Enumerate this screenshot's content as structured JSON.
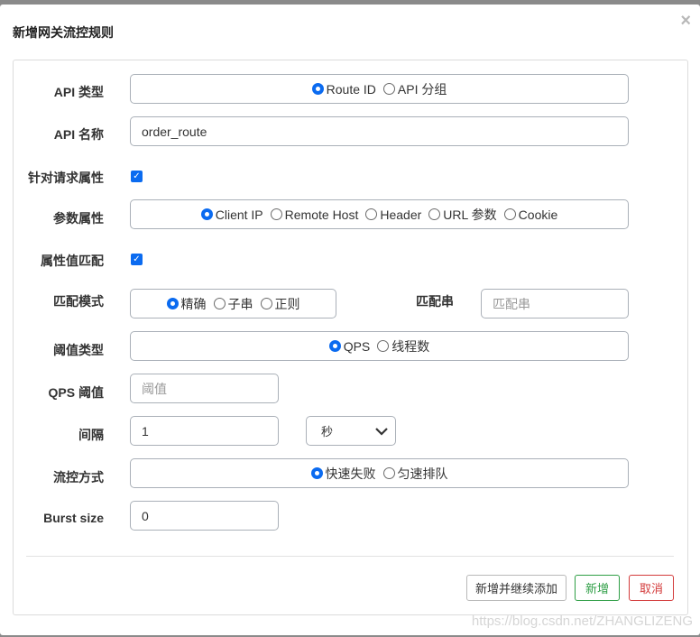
{
  "dialog": {
    "title": "新增网关流控规则",
    "close_glyph": "×"
  },
  "form": {
    "api_type": {
      "label": "API 类型",
      "options": [
        "Route ID",
        "API 分组"
      ],
      "selected": "Route ID"
    },
    "api_name": {
      "label": "API 名称",
      "value": "order_route"
    },
    "param_flag": {
      "label": "针对请求属性",
      "checked": true
    },
    "param_attr": {
      "label": "参数属性",
      "options": [
        "Client IP",
        "Remote Host",
        "Header",
        "URL 参数",
        "Cookie"
      ],
      "selected": "Client IP"
    },
    "match_flag": {
      "label": "属性值匹配",
      "checked": true
    },
    "match_mode": {
      "label": "匹配模式",
      "options": [
        "精确",
        "子串",
        "正则"
      ],
      "selected": "精确"
    },
    "match_str": {
      "label": "匹配串",
      "placeholder": "匹配串"
    },
    "threshold_type": {
      "label": "阈值类型",
      "options": [
        "QPS",
        "线程数"
      ],
      "selected": "QPS"
    },
    "qps": {
      "label": "QPS 阈值",
      "placeholder": "阈值"
    },
    "interval": {
      "label": "间隔",
      "value": "1",
      "unit": "秒"
    },
    "control": {
      "label": "流控方式",
      "options": [
        "快速失败",
        "匀速排队"
      ],
      "selected": "快速失败"
    },
    "burst": {
      "label": "Burst size",
      "value": "0"
    }
  },
  "buttons": {
    "add_continue": "新增并继续添加",
    "add": "新增",
    "cancel": "取消"
  },
  "watermark": "https://blog.csdn.net/ZHANGLIZENG",
  "colors": {
    "primary": "#0b6bf0",
    "success": "#2e9e45",
    "danger": "#d33a3a"
  }
}
